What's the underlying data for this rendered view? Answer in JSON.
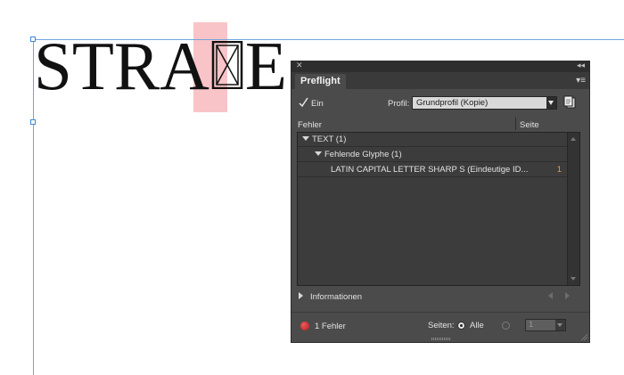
{
  "document": {
    "word_before": "STRA",
    "word_after": "E",
    "missing_glyph_icon": "missing-glyph-box-icon"
  },
  "panel": {
    "close_icon": "close-icon",
    "collapse_icon": "double-chevron-icon",
    "tab_label": "Preflight",
    "menu_icon": "panel-menu-icon",
    "enabled_label": "Ein",
    "enabled_checked": true,
    "profile_label": "Profil:",
    "profile_value": "Grundprofil (Kopie)",
    "columns": {
      "error": "Fehler",
      "page": "Seite"
    },
    "rows": [
      {
        "label": "TEXT (1)",
        "page": ""
      },
      {
        "label": "Fehlende Glyphe (1)",
        "page": ""
      },
      {
        "label": "LATIN CAPITAL LETTER SHARP S (Eindeutige ID...",
        "page": "1"
      }
    ],
    "info_label": "Informationen",
    "error_count_label": "1 Fehler",
    "pages_label": "Seiten:",
    "all_label": "Alle",
    "range_value": "1",
    "colors": {
      "error_dot": "#c62828",
      "page_number": "#e29d45",
      "highlight": "#f9c4c7"
    }
  }
}
